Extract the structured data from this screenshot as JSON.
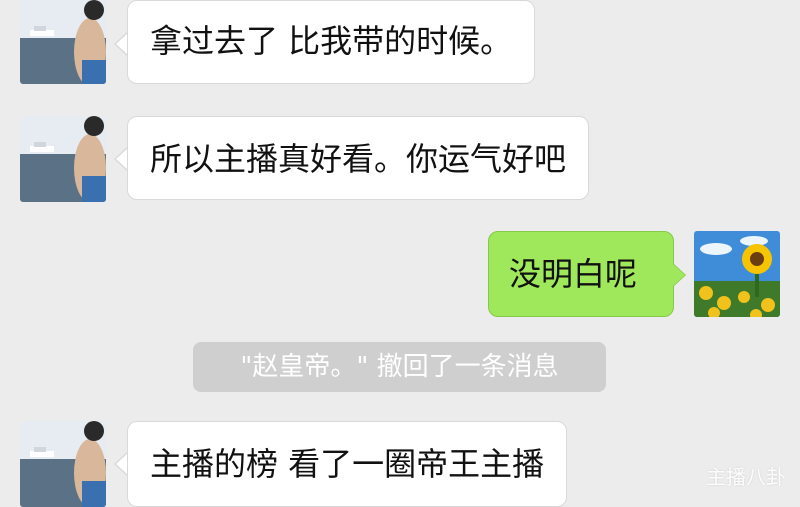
{
  "chat": {
    "messages": [
      {
        "side": "in",
        "text": "拿过去了 比我带的时候。"
      },
      {
        "side": "in",
        "text": "所以主播真好看。你运气好吧"
      },
      {
        "side": "out",
        "text": "没明白呢"
      },
      {
        "side": "system",
        "text": "\"赵皇帝。\" 撤回了一条消息"
      },
      {
        "side": "in",
        "text": "主播的榜 看了一圈帝王主播"
      }
    ]
  },
  "avatars": {
    "contact": "person-by-sea-avatar",
    "self": "sunflower-avatar"
  },
  "watermark": {
    "text": "主播八卦"
  },
  "colors": {
    "background": "#ececec",
    "incoming_bubble": "#ffffff",
    "outgoing_bubble": "#9fe75b",
    "system_notice": "#cfcfcf"
  }
}
